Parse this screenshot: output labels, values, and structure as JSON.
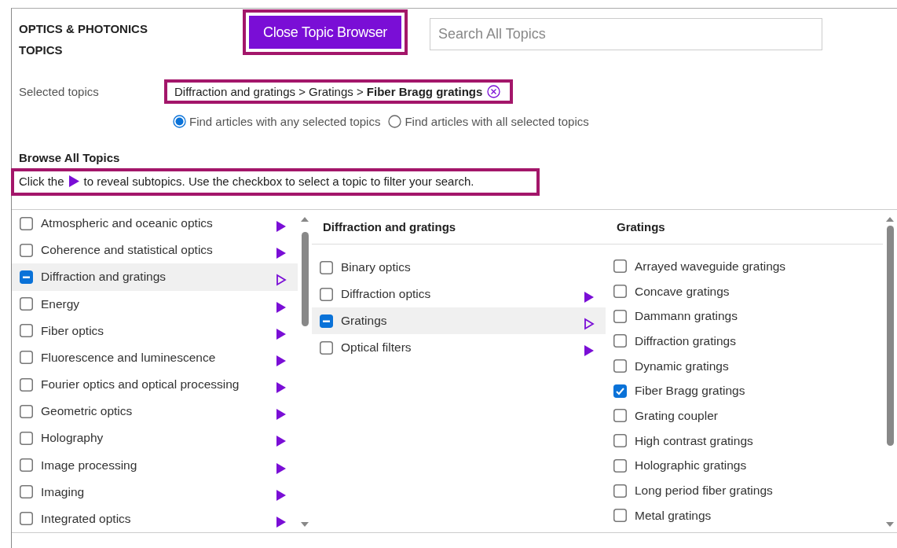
{
  "header": {
    "title": "OPTICS & PHOTONICS TOPICS",
    "close_button": "Close Topic Browser",
    "search": {
      "placeholder": "Search All Topics"
    }
  },
  "selected_topics": {
    "label": "Selected topics",
    "path": "Diffraction and gratings > Gratings > **Fiber Bragg gratings**"
  },
  "match_options": [
    {
      "label": "Find articles with any selected topics",
      "selected": true
    },
    {
      "label": "Find articles with all selected topics",
      "selected": false
    }
  ],
  "browse": {
    "title": "Browse All Topics",
    "hint_before": "Click the",
    "hint_after": "to reveal subtopics. Use the checkbox to select a topic to filter your search."
  },
  "columns": [
    {
      "items": [
        {
          "label": "Atmospheric and oceanic optics",
          "checked": false,
          "partial": false,
          "selected": false,
          "has_subtopics": true
        },
        {
          "label": "Coherence and statistical optics",
          "checked": false,
          "partial": false,
          "selected": false,
          "has_subtopics": true
        },
        {
          "label": "Diffraction and gratings",
          "checked": false,
          "partial": true,
          "selected": true,
          "has_subtopics": true
        },
        {
          "label": "Energy",
          "checked": false,
          "partial": false,
          "selected": false,
          "has_subtopics": true
        },
        {
          "label": "Fiber optics",
          "checked": false,
          "partial": false,
          "selected": false,
          "has_subtopics": true
        },
        {
          "label": "Fluorescence and luminescence",
          "checked": false,
          "partial": false,
          "selected": false,
          "has_subtopics": true
        },
        {
          "label": "Fourier optics and optical processing",
          "checked": false,
          "partial": false,
          "selected": false,
          "has_subtopics": true
        },
        {
          "label": "Geometric optics",
          "checked": false,
          "partial": false,
          "selected": false,
          "has_subtopics": true
        },
        {
          "label": "Holography",
          "checked": false,
          "partial": false,
          "selected": false,
          "has_subtopics": true
        },
        {
          "label": "Image processing",
          "checked": false,
          "partial": false,
          "selected": false,
          "has_subtopics": true
        },
        {
          "label": "Imaging",
          "checked": false,
          "partial": false,
          "selected": false,
          "has_subtopics": true
        },
        {
          "label": "Integrated optics",
          "checked": false,
          "partial": false,
          "selected": false,
          "has_subtopics": true
        }
      ]
    },
    {
      "heading": "Diffraction and gratings",
      "items": [
        {
          "label": "Binary optics",
          "checked": false,
          "partial": false,
          "selected": false,
          "has_subtopics": false
        },
        {
          "label": "Diffraction optics",
          "checked": false,
          "partial": false,
          "selected": false,
          "has_subtopics": true
        },
        {
          "label": "Gratings",
          "checked": false,
          "partial": true,
          "selected": true,
          "has_subtopics": true
        },
        {
          "label": "Optical filters",
          "checked": false,
          "partial": false,
          "selected": false,
          "has_subtopics": true
        }
      ]
    },
    {
      "heading": "Gratings",
      "items": [
        {
          "label": "Arrayed waveguide gratings",
          "checked": false,
          "partial": false,
          "selected": false,
          "has_subtopics": false
        },
        {
          "label": "Concave gratings",
          "checked": false,
          "partial": false,
          "selected": false,
          "has_subtopics": false
        },
        {
          "label": "Dammann gratings",
          "checked": false,
          "partial": false,
          "selected": false,
          "has_subtopics": false
        },
        {
          "label": "Diffraction gratings",
          "checked": false,
          "partial": false,
          "selected": false,
          "has_subtopics": false
        },
        {
          "label": "Dynamic gratings",
          "checked": false,
          "partial": false,
          "selected": false,
          "has_subtopics": false
        },
        {
          "label": "Fiber Bragg gratings",
          "checked": true,
          "partial": false,
          "selected": false,
          "has_subtopics": false
        },
        {
          "label": "Grating coupler",
          "checked": false,
          "partial": false,
          "selected": false,
          "has_subtopics": false
        },
        {
          "label": "High contrast gratings",
          "checked": false,
          "partial": false,
          "selected": false,
          "has_subtopics": false
        },
        {
          "label": "Holographic gratings",
          "checked": false,
          "partial": false,
          "selected": false,
          "has_subtopics": false
        },
        {
          "label": "Long period fiber gratings",
          "checked": false,
          "partial": false,
          "selected": false,
          "has_subtopics": false
        },
        {
          "label": "Metal gratings",
          "checked": false,
          "partial": false,
          "selected": false,
          "has_subtopics": false
        }
      ]
    }
  ]
}
